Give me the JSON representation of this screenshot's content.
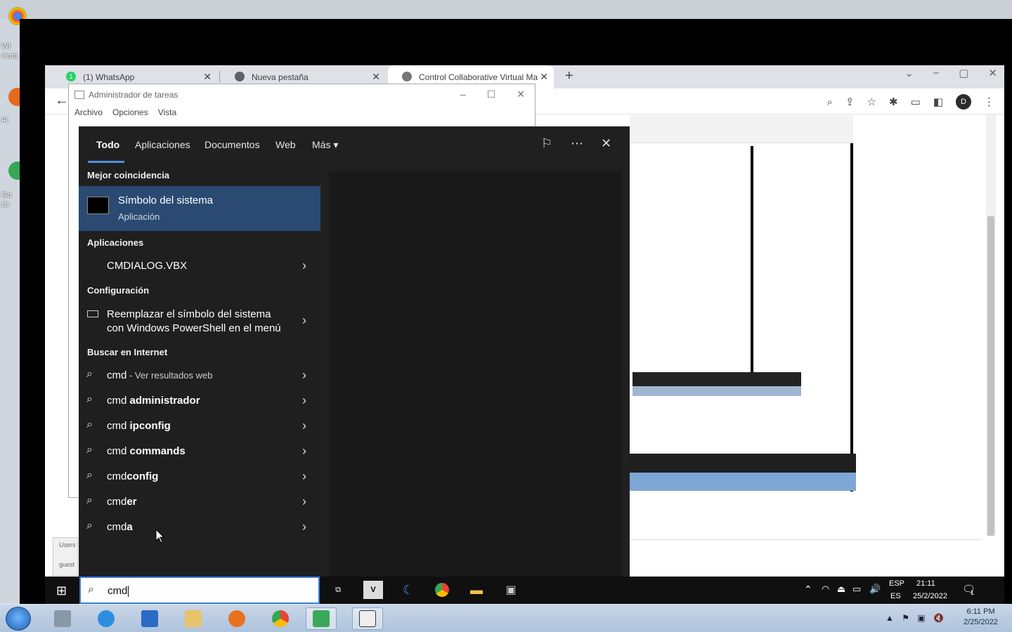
{
  "desktop": {
    "icon_labels": [
      "Wi",
      "Com",
      "Fi",
      "Go",
      "Cr"
    ]
  },
  "remote_chrome": {
    "tabs": [
      {
        "label": "(1) WhatsApp",
        "badge": "1"
      },
      {
        "label": "Nueva pestaña"
      },
      {
        "label": "Control Collaborative Virtual Ma"
      }
    ],
    "new_tab": "+",
    "window_controls": {
      "minimize": "–",
      "maximize": "▢",
      "close": "✕"
    },
    "back": "←",
    "profile_initial": "D"
  },
  "task_manager": {
    "title": "Administrador de tareas",
    "menu": [
      "Archivo",
      "Opciones",
      "Vista"
    ],
    "controls": {
      "minimize": "–",
      "maximize": "☐",
      "close": "✕"
    }
  },
  "users_panel": {
    "label": "Users",
    "value": "guest"
  },
  "search": {
    "tabs": [
      "Todo",
      "Aplicaciones",
      "Documentos",
      "Web",
      "Más ▾"
    ],
    "active_tab": "Todo",
    "best_match_heading": "Mejor coincidencia",
    "best_match": {
      "name": "Símbolo del sistema",
      "type": "Aplicación"
    },
    "apps_heading": "Aplicaciones",
    "apps": [
      {
        "label": "CMDIALOG.VBX"
      }
    ],
    "settings_heading": "Configuración",
    "settings": [
      {
        "line1": "Reemplazar el símbolo del sistema",
        "line2": "con Windows PowerShell en el menú"
      }
    ],
    "web_heading": "Buscar en Internet",
    "web_results": [
      {
        "prefix": "cmd",
        "bold": "",
        "suffix": " - Ver resultados web"
      },
      {
        "prefix": "cmd ",
        "bold": "administrador",
        "suffix": ""
      },
      {
        "prefix": "cmd ",
        "bold": "ipconfig",
        "suffix": ""
      },
      {
        "prefix": "cmd ",
        "bold": "commands",
        "suffix": ""
      },
      {
        "prefix": "cmd",
        "bold": "config",
        "suffix": ""
      },
      {
        "prefix": "cmd",
        "bold": "er",
        "suffix": ""
      },
      {
        "prefix": "cmd",
        "bold": "a",
        "suffix": ""
      }
    ],
    "query": "cmd"
  },
  "remote_taskbar": {
    "tray": {
      "lang1": "ESP",
      "lang2": "ES",
      "time": "21:11",
      "date": "25/2/2022",
      "notif_count": "1"
    }
  },
  "local_taskbar": {
    "time": "6:11 PM",
    "date": "2/25/2022"
  },
  "colors": {
    "search_bg": "#202020",
    "best_match_bg": "#2a4a72",
    "accent": "#4f8fe0"
  }
}
